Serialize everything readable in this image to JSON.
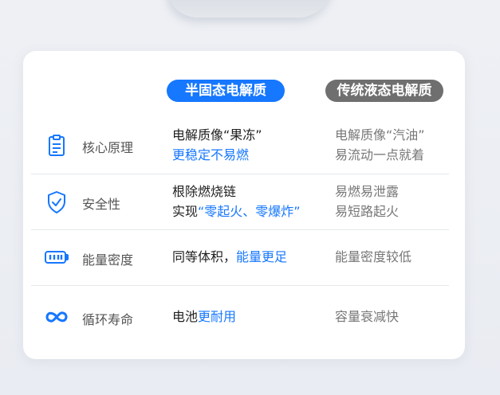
{
  "header": {
    "col_solid": "半固态电解质",
    "col_liquid": "传统液态电解质"
  },
  "rows": [
    {
      "category": "核心原理",
      "icon": "clipboard-icon",
      "solid": {
        "line1": "电解质像“果冻”",
        "line2": "更稳定不易燃"
      },
      "liquid": {
        "line1": "电解质像“汽油”",
        "line2": "易流动一点就着"
      }
    },
    {
      "category": "安全性",
      "icon": "shield-check-icon",
      "solid": {
        "line1": "根除燃烧链",
        "line2_prefix": "实现",
        "line2_highlight": "“零起火、零爆炸”"
      },
      "liquid": {
        "line1": "易燃易泄露",
        "line2": "易短路起火"
      }
    },
    {
      "category": "能量密度",
      "icon": "battery-icon",
      "solid": {
        "prefix": "同等体积，",
        "highlight": "能量更足"
      },
      "liquid": {
        "text": "能量密度较低"
      }
    },
    {
      "category": "循环寿命",
      "icon": "infinity-icon",
      "solid": {
        "prefix": "电池",
        "highlight": "更耐用"
      },
      "liquid": {
        "text": "容量衰减快"
      }
    }
  ],
  "colors": {
    "accent": "#1677ff",
    "legacy_gray": "#6f6f6f",
    "card_bg": "#ffffff",
    "page_bg": "#eef0f4"
  }
}
